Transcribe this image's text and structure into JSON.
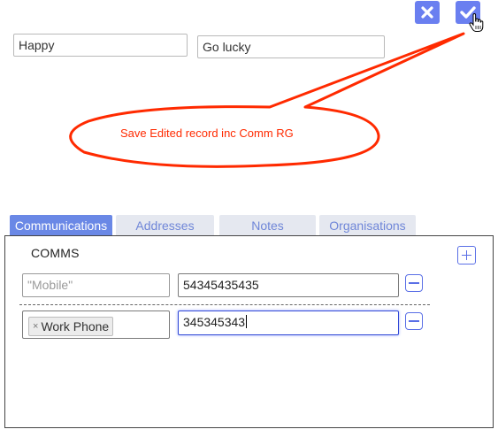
{
  "actions": {
    "cancel_icon": "close-icon",
    "confirm_icon": "check-icon",
    "accent_color": "#6a7ff0"
  },
  "name": {
    "first": "Happy",
    "last": "Go lucky"
  },
  "annotation": {
    "text": "Save Edited record inc Comm RG",
    "color": "#ff2a00"
  },
  "tabs": [
    {
      "label": "Communications",
      "active": true
    },
    {
      "label": "Addresses",
      "active": false
    },
    {
      "label": "Notes",
      "active": false
    },
    {
      "label": "Organisations",
      "active": false
    }
  ],
  "comms": {
    "title": "COMMS",
    "rows": [
      {
        "type_placeholder": "\"Mobile\"",
        "value": "54345435435"
      },
      {
        "type_value": "Work Phone",
        "chip_remove": "×",
        "value": "345345343"
      }
    ]
  }
}
